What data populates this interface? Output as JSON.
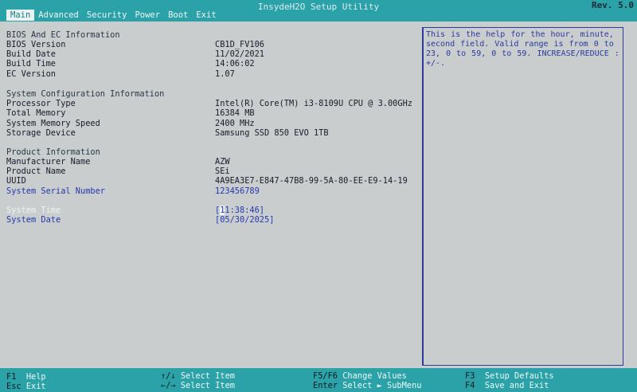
{
  "header": {
    "title": "InsydeH2O Setup Utility",
    "version": "Rev. 5.0",
    "menu": [
      "Main",
      "Advanced",
      "Security",
      "Power",
      "Boot",
      "Exit"
    ]
  },
  "bios": {
    "section_title": "BIOS And EC Information",
    "bios_version_label": "BIOS Version",
    "bios_version_value": "CB1D_FV106",
    "build_date_label": "Build Date",
    "build_date_value": "11/02/2021",
    "build_time_label": "Build Time",
    "build_time_value": "14:06:02",
    "ec_version_label": "EC Version",
    "ec_version_value": "1.07"
  },
  "system": {
    "section_title": "System Configuration Information",
    "processor_label": "Processor Type",
    "processor_value": "Intel(R) Core(TM) i3-8109U CPU @ 3.00GHz",
    "memory_label": "Total Memory",
    "memory_value": "16384 MB",
    "speed_label": "System Memory Speed",
    "speed_value": "2400 MHz",
    "storage_label": "Storage Device",
    "storage_value": "Samsung SSD 850 EVO 1TB"
  },
  "product": {
    "section_title": "Product Information",
    "manufacturer_label": "Manufacturer Name",
    "manufacturer_value": "AZW",
    "product_label": "Product Name",
    "product_value": "SEi",
    "uuid_label": "UUID",
    "uuid_value": "4A9EA3E7-E847-47B8-99-5A-80-EE-E9-14-19",
    "serial_label": "System Serial Number",
    "serial_value": "123456789"
  },
  "datetime": {
    "time_label": "System Time",
    "time_open": "[",
    "time_cursor": "1",
    "time_rest": "1:38:46]",
    "date_label": "System Date",
    "date_value": "[05/30/2025]"
  },
  "help": {
    "text": "This is the help for the hour, minute, second field. Valid range is from 0 to 23, 0 to 59, 0 to 59. INCREASE/REDUCE : +/-."
  },
  "footer": {
    "f1_key": "F1",
    "f1_desc": "Help",
    "esc_key": "Esc",
    "esc_desc": "Exit",
    "updown_key": "↑/↓",
    "updown_desc": "Select Item",
    "leftright_key": "←/→",
    "leftright_desc": "Select Item",
    "f5f6_key": "F5/F6",
    "f5f6_desc": "Change Values",
    "enter_key": "Enter",
    "enter_desc": "Select ► SubMenu",
    "f3_key": "F3",
    "f3_desc": "Setup Defaults",
    "f4_key": "F4",
    "f4_desc": "Save and Exit"
  }
}
